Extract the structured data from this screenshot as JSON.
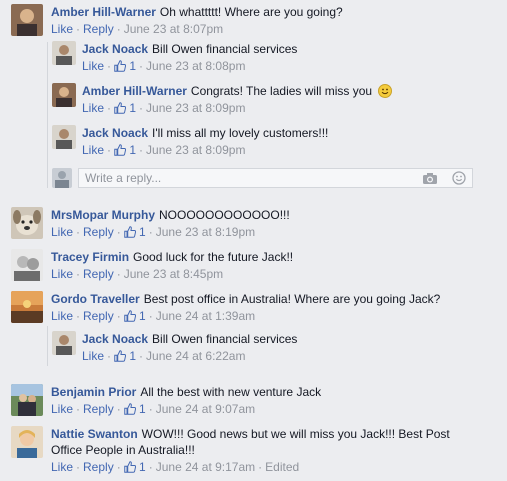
{
  "labels": {
    "like": "Like",
    "reply": "Reply",
    "edited": "Edited",
    "write_reply_placeholder": "Write a reply..."
  },
  "comments": [
    {
      "name": "Amber Hill-Warner",
      "text": "Oh whattttt! Where are you going?",
      "time": "June 23 at 8:07pm"
    },
    {
      "name": "Jack Noack",
      "text": "Bill Owen financial services",
      "time": "June 23 at 8:08pm",
      "likes": "1"
    },
    {
      "name": "Amber Hill-Warner",
      "text": "Congrats! The ladies will miss you",
      "time": "June 23 at 8:09pm",
      "likes": "1"
    },
    {
      "name": "Jack Noack",
      "text": "I'll miss all my lovely customers!!!",
      "time": "June 23 at 8:09pm",
      "likes": "1"
    },
    {
      "name": "MrsMopar Murphy",
      "text": "NOOOOOOOOOOOO!!!",
      "time": "June 23 at 8:19pm",
      "likes": "1"
    },
    {
      "name": "Tracey Firmin",
      "text": "Good luck for the future Jack!!",
      "time": "June 23 at 8:45pm"
    },
    {
      "name": "Gordo Traveller",
      "text": "Best post office in Australia! Where are you going Jack?",
      "time": "June 24 at 1:39am",
      "likes": "1"
    },
    {
      "name": "Jack Noack",
      "text": "Bill Owen financial services",
      "time": "June 24 at 6:22am",
      "likes": "1"
    },
    {
      "name": "Benjamin Prior",
      "text": "All the best with new venture Jack",
      "time": "June 24 at 9:07am",
      "likes": "1"
    },
    {
      "name": "Nattie Swanton",
      "text": "WOW!!! Good news but we will miss you Jack!!! Best Post Office People in Australia!!!",
      "time": "June 24 at 9:17am",
      "likes": "1"
    }
  ],
  "colors": {
    "name": "#365899",
    "link": "#4267b2",
    "meta": "#90949c",
    "background": "#ecedf0"
  }
}
